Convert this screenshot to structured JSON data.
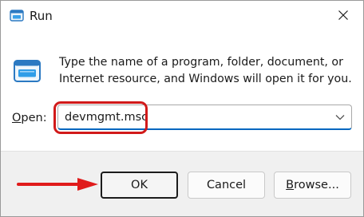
{
  "window": {
    "title": "Run",
    "icons": {
      "title": "run-app-icon",
      "close": "close-icon",
      "dialog": "run-dialog-icon",
      "dropdown": "chevron-down-icon"
    }
  },
  "content": {
    "description": "Type the name of a program, folder, document, or Internet resource, and Windows will open it for you.",
    "open_label_accel": "O",
    "open_label_rest": "pen:",
    "command_value": "devmgmt.msc"
  },
  "footer": {
    "ok_label": "OK",
    "cancel_label": "Cancel",
    "browse_accel": "B",
    "browse_rest": "rowse..."
  },
  "annotations": {
    "highlight_color": "#d11a1a",
    "arrow_color": "#e01b1b"
  },
  "theme": {
    "accent": "#0067c0",
    "footer_bg": "#f0f0f0"
  }
}
